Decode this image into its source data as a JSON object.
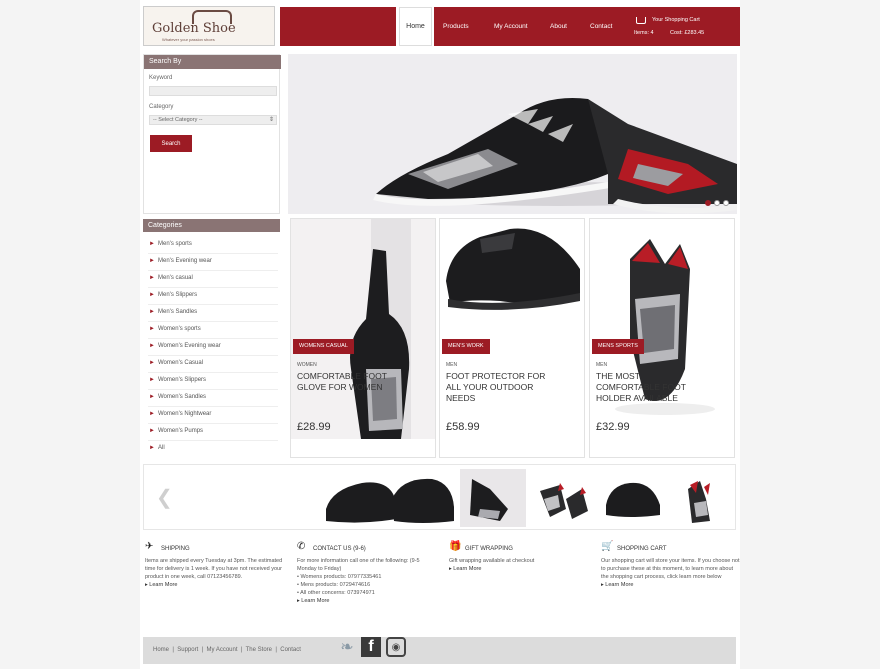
{
  "header": {
    "logo_text": "Golden Shoe",
    "logo_tagline": "Whatever your passion shoes",
    "nav": [
      "Home",
      "Products",
      "My Account",
      "About",
      "Contact"
    ],
    "cart_label": "Your Shopping Cart",
    "cart_items": "Items: 4",
    "cart_cost": "Cost: £283.45"
  },
  "search": {
    "title": "Search By",
    "keyword_label": "Keyword",
    "category_label": "Category",
    "category_value": "-- Select Category --",
    "button": "Search"
  },
  "categories": {
    "title": "Categories",
    "items": [
      "Men's sports",
      "Men's Evening wear",
      "Men's casual",
      "Men's Slippers",
      "Men's Sandles",
      "Women's sports",
      "Women's Evening wear",
      "Women's Casual",
      "Women's Slippers",
      "Women's Sandles",
      "Women's Nightwear",
      "Women's Pumps",
      "All"
    ]
  },
  "products": [
    {
      "ribbon": "WOMENS CASUAL",
      "type": "WOMEN",
      "name": "COMFORTABLE FOOT GLOVE FOR WOMEN",
      "price": "£28.99"
    },
    {
      "ribbon": "MEN'S WORK",
      "type": "MEN",
      "name": "FOOT PROTECTOR FOR ALL YOUR OUTDOOR NEEDS",
      "price": "£58.99"
    },
    {
      "ribbon": "MENS SPORTS",
      "type": "MEN",
      "name": "THE MOST COMFORTABLE FOOT HOLDER AVAILABLE",
      "price": "£32.99"
    }
  ],
  "info": [
    {
      "title": "SHIPPING",
      "icon": "plane-icon",
      "text": "Items are shipped every Tuesday at 3pm. The estimated time for delivery is 1 week. If you have not received your product in one week, call 07123456789.",
      "more": "Learn More"
    },
    {
      "title": "CONTACT US (9-6)",
      "icon": "phone-icon",
      "text": "For more information call one of the following: (9-5 Monday to Friday)",
      "list": [
        "Womens products: 07977335461",
        "Mens products: 0729474616",
        "All other concerns: 073974971"
      ],
      "more": "Learn More"
    },
    {
      "title": "GIFT WRAPPING",
      "icon": "gift-icon",
      "text": "Gift wrapping available at checkout",
      "more": "Learn More"
    },
    {
      "title": "SHOPPING CART",
      "icon": "cart-icon",
      "text": "Our shopping cart will store your items. If you choose not to purchase these at this moment, to learn more about the shopping cart process, click learn more below",
      "more": "Learn More"
    }
  ],
  "footer": {
    "links": [
      "Home",
      "Support",
      "My Account",
      "The Store",
      "Contact"
    ]
  },
  "colors": {
    "accent": "#9c1b24",
    "box_head": "#8a7474"
  }
}
